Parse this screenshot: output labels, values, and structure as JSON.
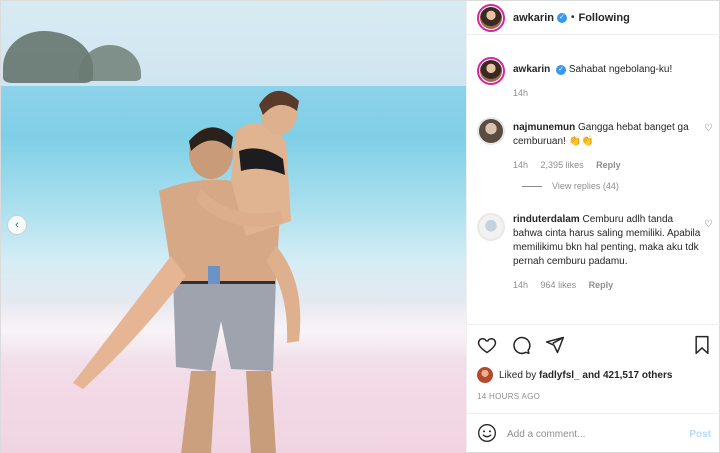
{
  "post": {
    "author": "awkarin",
    "follow_label": "Following",
    "separator": "•"
  },
  "caption": {
    "author": "awkarin",
    "text": "Sahabat ngebolang-ku!",
    "time": "14h"
  },
  "comments": [
    {
      "user": "najmunemun",
      "text": "Gangga hebat banget ga cemburuan! 👏👏",
      "time": "14h",
      "likes": "2,395 likes",
      "reply": "Reply"
    },
    {
      "user": "rinduterdalam",
      "text": "Cemburu adlh tanda bahwa cinta harus saling memiliki. Apabila memilikimu bkn hal penting, maka aku tdk pernah cemburu padamu.",
      "time": "14h",
      "likes": "964 likes",
      "reply": "Reply"
    }
  ],
  "view_replies": "View replies (44)",
  "likes": {
    "prefix": "Liked by",
    "user": "fadlyfsl_",
    "rest": "and 421,517 others"
  },
  "timestamp": "14 HOURS AGO",
  "comment_box": {
    "placeholder": "Add a comment...",
    "post_label": "Post"
  },
  "icons": {
    "verified": "verified-badge-icon",
    "heart": "heart-icon",
    "comment": "comment-icon",
    "share": "share-icon",
    "bookmark": "bookmark-icon",
    "emoji": "emoji-icon",
    "prev": "chevron-left-icon"
  },
  "colors": {
    "verified": "#3897f0",
    "post_button": "#b3dbff",
    "muted_text": "#8e8e8e"
  }
}
